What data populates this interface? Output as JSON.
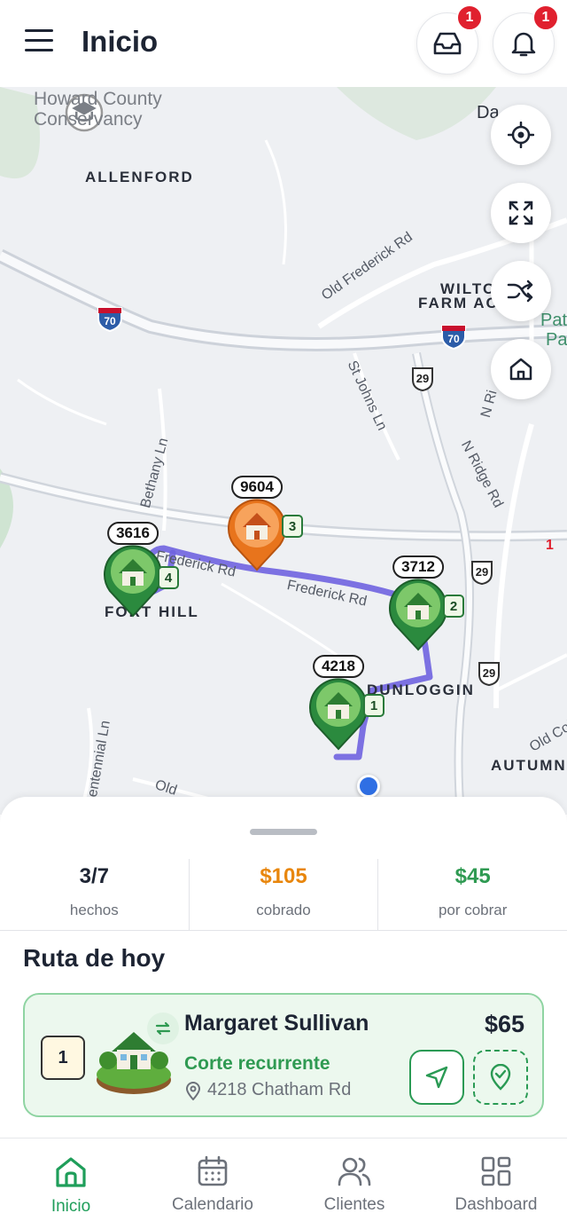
{
  "header": {
    "title": "Inicio",
    "inbox_badge": "1",
    "notifications_badge": "1"
  },
  "map": {
    "poi": [
      "Howard County",
      "Conservancy"
    ],
    "labels": {
      "allenford": "ALLENFORD",
      "old_frederick": "Old Frederick Rd",
      "wilton_1": "WILTO",
      "wilton_2": "FARM AC",
      "st_johns": "St Johns Ln",
      "bethany": "Bethany Ln",
      "frederick_1": "Frederick Rd",
      "frederick_2": "Frederick Rd",
      "n_ridge": "N Ridge Rd",
      "n_ri": "N Ri",
      "fort_hill": "FORT HILL",
      "dunloggin": "DUNLOGGIN",
      "old_col": "Old Col",
      "autumn": "AUTUMN",
      "centennial": "Centennial Ln",
      "old_b": "Old",
      "da": "Da",
      "pat_1": "Pat",
      "pat_2": "Pa",
      "shield_70a": "70",
      "shield_70b": "70",
      "shield_29a": "29",
      "shield_29b": "29",
      "shield_29c": "29",
      "side_one": "1"
    },
    "pins": [
      {
        "label": "3616",
        "num": "4",
        "color": "green"
      },
      {
        "label": "9604",
        "num": "3",
        "color": "orange"
      },
      {
        "label": "3712",
        "num": "2",
        "color": "green"
      },
      {
        "label": "4218",
        "num": "1",
        "color": "green"
      }
    ]
  },
  "stats": [
    {
      "value": "3/7",
      "label": "hechos",
      "color": "#1d2433"
    },
    {
      "value": "$105",
      "label": "cobrado",
      "color": "#e8860c"
    },
    {
      "value": "$45",
      "label": "por cobrar",
      "color": "#2f9a52"
    }
  ],
  "route": {
    "title": "Ruta de hoy",
    "card": {
      "order": "1",
      "name": "Margaret Sullivan",
      "service": "Corte recurrente",
      "address": "4218 Chatham Rd",
      "price": "$65"
    }
  },
  "nav": [
    {
      "label": "Inicio",
      "icon": "home-icon",
      "active": true
    },
    {
      "label": "Calendario",
      "icon": "calendar-icon",
      "active": false
    },
    {
      "label": "Clientes",
      "icon": "users-icon",
      "active": false
    },
    {
      "label": "Dashboard",
      "icon": "dashboard-icon",
      "active": false
    }
  ],
  "colors": {
    "accent": "#1f9e5a",
    "badge": "#e0202e",
    "route": "#6f63e0",
    "collected": "#e8860c"
  }
}
